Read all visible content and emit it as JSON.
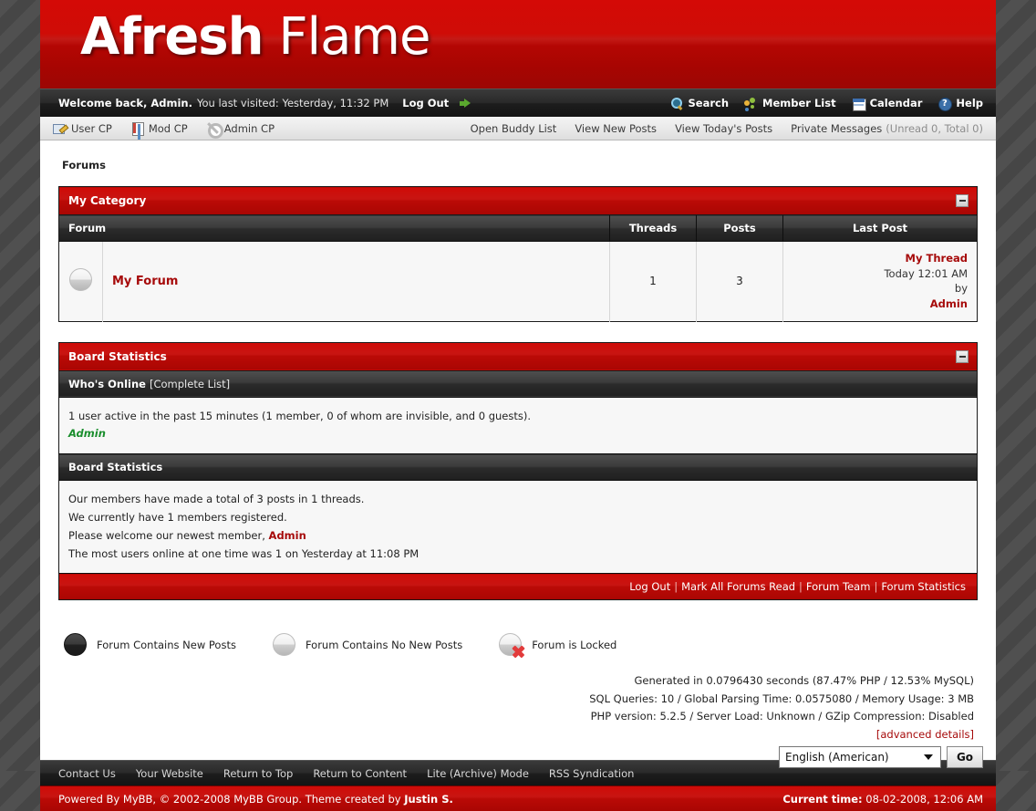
{
  "logo": {
    "bold": "Afresh",
    "light": "Flame"
  },
  "welcome": {
    "greeting": "Welcome back, Admin.",
    "last_visit": "You last visited: Yesterday, 11:32 PM",
    "logout": "Log Out",
    "links": [
      {
        "label": "Search",
        "icon": "search-icon"
      },
      {
        "label": "Member List",
        "icon": "members-icon"
      },
      {
        "label": "Calendar",
        "icon": "calendar-icon"
      },
      {
        "label": "Help",
        "icon": "help-icon"
      }
    ]
  },
  "nav": {
    "left": [
      {
        "label": "User CP",
        "icon": "usercp-icon"
      },
      {
        "label": "Mod CP",
        "icon": "modcp-icon"
      },
      {
        "label": "Admin CP",
        "icon": "gear-icon"
      }
    ],
    "right": [
      "Open Buddy List",
      "View New Posts",
      "View Today's Posts"
    ],
    "pm_label": "Private Messages",
    "pm_counts": "(Unread 0, Total 0)"
  },
  "breadcrumb": "Forums",
  "category": {
    "title": "My Category",
    "columns": [
      "Forum",
      "Threads",
      "Posts",
      "Last Post"
    ],
    "rows": [
      {
        "icon": "forum-no-new-posts-icon",
        "name": "My Forum",
        "threads": "1",
        "posts": "3",
        "last_post_thread": "My Thread",
        "last_post_time": "Today 12:01 AM",
        "last_post_by_prefix": "by ",
        "last_post_author": "Admin"
      }
    ]
  },
  "board_statistics": {
    "title": "Board Statistics",
    "whos_online": {
      "heading": "Who's Online",
      "complete_list": "[Complete List]",
      "summary": "1 user active in the past 15 minutes (1 member, 0 of whom are invisible, and 0 guests).",
      "members": "Admin"
    },
    "stats": {
      "heading": "Board Statistics",
      "line1": "Our members have made a total of 3 posts in 1 threads.",
      "line2": "We currently have 1 members registered.",
      "line3_prefix": "Please welcome our newest member, ",
      "line3_member": "Admin",
      "line4": "The most users online at one time was 1 on Yesterday at 11:08 PM"
    },
    "footer_links": [
      "Log Out",
      "Mark All Forums Read",
      "Forum Team",
      "Forum Statistics"
    ]
  },
  "legend": [
    {
      "icon": "forum-new-posts-icon",
      "label": "Forum Contains New Posts"
    },
    {
      "icon": "forum-no-new-posts-icon",
      "label": "Forum Contains No New Posts"
    },
    {
      "icon": "forum-locked-icon",
      "label": "Forum is Locked"
    }
  ],
  "generation": {
    "line1": "Generated in 0.0796430 seconds (87.47% PHP / 12.53% MySQL)",
    "line2": "SQL Queries: 10 / Global Parsing Time: 0.0575080 / Memory Usage: 3 MB",
    "line3": "PHP version: 5.2.5 / Server Load: Unknown / GZip Compression: Disabled",
    "advanced": "[advanced details]"
  },
  "footer": {
    "links": [
      "Contact Us",
      "Your Website",
      "Return to Top",
      "Return to Content",
      "Lite (Archive) Mode",
      "RSS Syndication"
    ],
    "language_selected": "English (American)",
    "go_label": "Go",
    "powered_prefix": "Powered By MyBB, © 2002-2008 MyBB Group. Theme created by ",
    "theme_author": "Justin S.",
    "current_time_label": "Current time:",
    "current_time_value": "08-02-2008, 12:06 AM"
  },
  "colors": {
    "accent_red": "#c81512",
    "dark_bar": "#2a2a2a",
    "link_red": "#a60a0a",
    "online_green": "#1a8e2d"
  }
}
